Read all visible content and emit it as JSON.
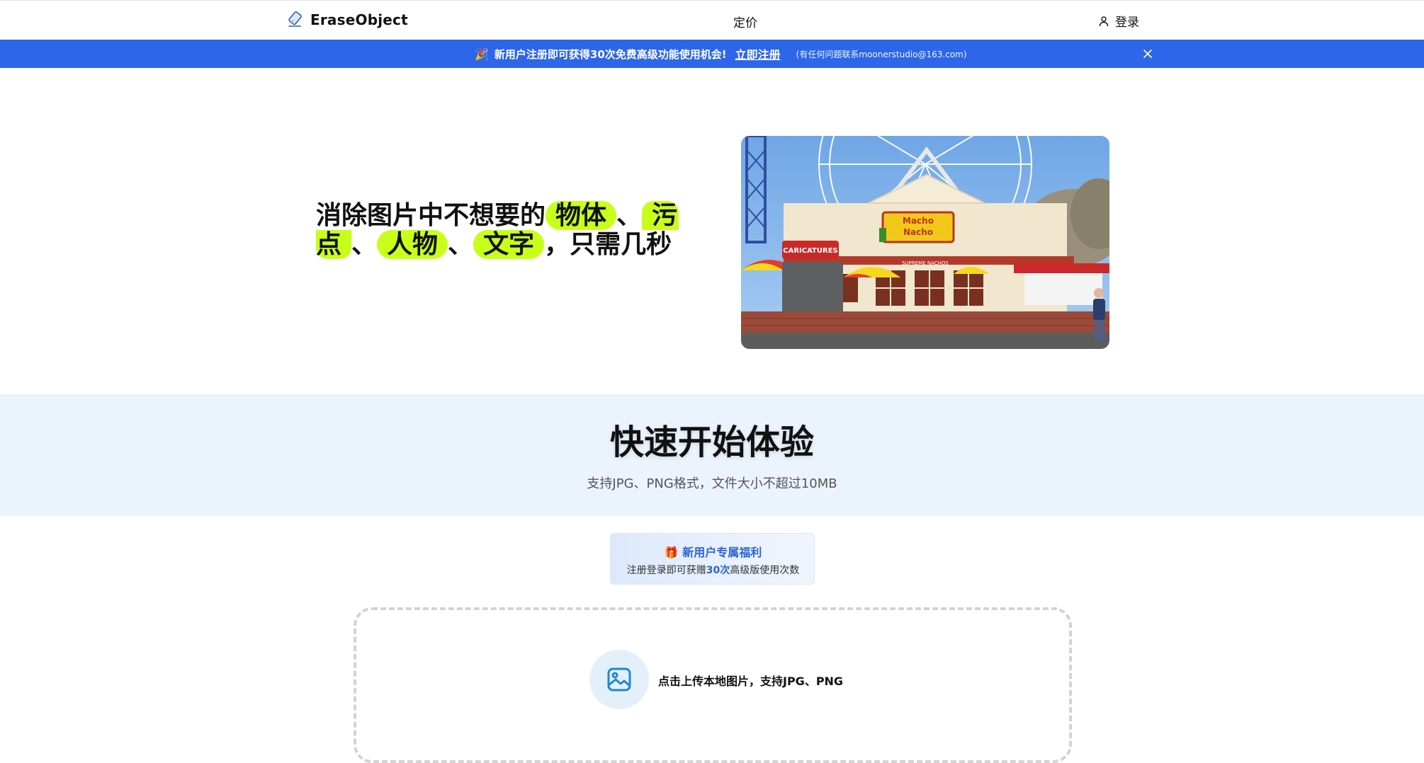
{
  "header": {
    "logo_text": "EraseObject",
    "nav_pricing": "定价",
    "login_label": "登录"
  },
  "banner": {
    "emoji": "🎉",
    "text": "新用户注册即可获得30次免费高级功能使用机会!",
    "link": "立即注册",
    "contact": "(有任何问题联系moonerstudio@163.com)"
  },
  "hero": {
    "title_part1": "消除图片中不想要的",
    "highlight1": "物体",
    "sep1": "、",
    "highlight2a": "污",
    "highlight2b": "点",
    "sep2": "、",
    "highlight3": "人物",
    "sep3": "、",
    "highlight4": "文字",
    "title_end": "，只需几秒",
    "image_signs": {
      "sign1": "Macho Nacho",
      "sign2": "CARICATURES",
      "sign3": "SUPREME NACHOS"
    }
  },
  "quick_start": {
    "title": "快速开始体验",
    "subtitle": "支持JPG、PNG格式，文件大小不超过10MB"
  },
  "promo": {
    "icon": "🎁",
    "title": "新用户专属福利",
    "desc_pre": "注册登录即可获赠",
    "desc_highlight": "30次",
    "desc_post": "高级版使用次数"
  },
  "upload": {
    "text": "点击上传本地图片，支持JPG、PNG"
  },
  "colors": {
    "banner_bg": "#2d66e9",
    "highlight": "#c8ff1a",
    "quick_bg": "#ebf3fd",
    "accent": "#2b63d6"
  }
}
